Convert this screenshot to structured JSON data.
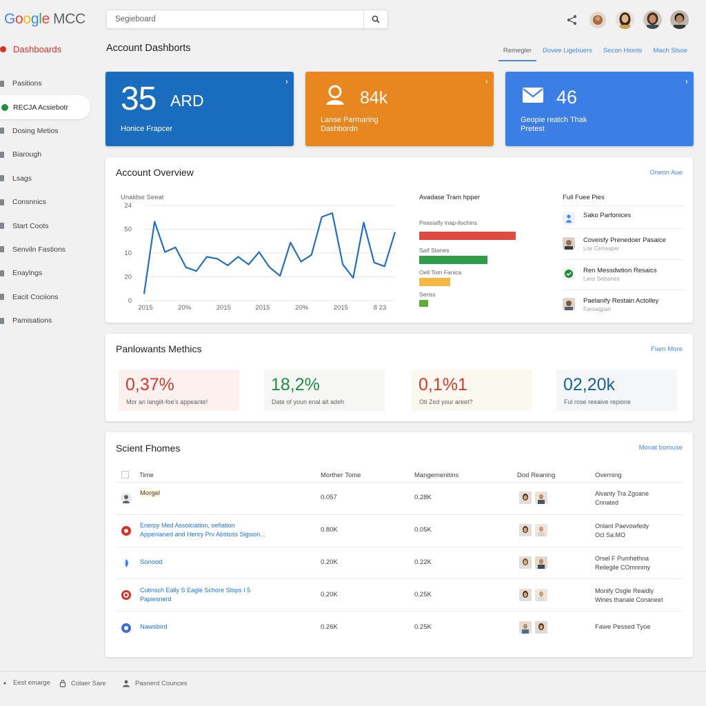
{
  "app": {
    "logo_word": "Google",
    "logo_suffix": "MCC"
  },
  "search": {
    "value": "Segieboard"
  },
  "sidebar": {
    "dashboards_label": "Dashboards",
    "items": [
      {
        "label": "Pasitions"
      },
      {
        "label": "RECJA Acsiebotr"
      },
      {
        "label": "Dosing Metios"
      },
      {
        "label": "Biarough"
      },
      {
        "label": "Lsags"
      },
      {
        "label": "Consnnics"
      },
      {
        "label": "Start Coots"
      },
      {
        "label": "Senviln Fastions"
      },
      {
        "label": "Enaylngs"
      },
      {
        "label": "Eacit Cociions"
      },
      {
        "label": "Pamisations"
      }
    ]
  },
  "header": {
    "title": "Account Dashborts",
    "tabs": [
      "Remegler",
      "Dovee Ligebuers",
      "Secon Hionts",
      "Mach Slsoe"
    ]
  },
  "kpis": [
    {
      "value": "35",
      "unit": "ARD",
      "label": "Honice Frapcer",
      "color": "#1a6cbf"
    },
    {
      "value": "84k",
      "label_line1": "Lanse Parmaring",
      "label_line2": "Dashbordn",
      "color": "#e8861f"
    },
    {
      "value": "46",
      "label_line1": "Geopie reatch Thak",
      "label_line2": "Pretest",
      "color": "#3b7ee6"
    }
  ],
  "overview": {
    "title": "Account Overview",
    "link": "Onenn Aue",
    "chart_title": "Unaldse Seeat",
    "bars_title": "Avadase Tram hpper",
    "bars": [
      {
        "label": "Peasiafly inap-ilochins",
        "value": 0.78,
        "color": "#e04b3f"
      },
      {
        "label": "Saif Stanes",
        "value": 0.55,
        "color": "#2e9e48"
      },
      {
        "label": "Oell Tom Fanica",
        "value": 0.25,
        "color": "#f5b942"
      },
      {
        "label": "Seriss",
        "value": 0.07,
        "color": "#5fae3a"
      }
    ],
    "list_title": "Full Fuee Pies",
    "list": [
      {
        "title": "Sako Parfonices",
        "sub": "",
        "icon": "person-icon"
      },
      {
        "title": "Coveisfy Prenedoer Pasaice",
        "sub": "Loe Cemsaper",
        "icon": "avatar-icon"
      },
      {
        "title": "Ren Messdwtion Resaics",
        "sub": "Lans Setssnes",
        "icon": "circle-check-icon"
      },
      {
        "title": "Paelanify Restain Actolley",
        "sub": "Fansagpan",
        "icon": "avatar-icon"
      }
    ]
  },
  "chart_data": {
    "type": "line",
    "title": "Unaldse Seeat",
    "y_tick_labels": [
      "24",
      "50",
      "10",
      "20",
      "0"
    ],
    "x_tick_labels": [
      "2015",
      "20%",
      "2015",
      "2015",
      "20%",
      "2015",
      "8 23"
    ],
    "series": [
      {
        "values": [
          7,
          83,
          51,
          56,
          35,
          31,
          46,
          44,
          37,
          46,
          38,
          51,
          35,
          26,
          61,
          41,
          48,
          88,
          92,
          38,
          24,
          82,
          40,
          36,
          72
        ]
      }
    ],
    "ylim": [
      0,
      100
    ],
    "grid": true,
    "color": "#1f6fc7"
  },
  "metrics": {
    "title": "Panlowants Methics",
    "link": "Fiarn More",
    "items": [
      {
        "value": "0,37%",
        "label": "Mor an langiit-foe's appeante!",
        "color": "#d33a2c",
        "bg": "#fdf1ef"
      },
      {
        "value": "18,2%",
        "label": "Date of youn enal alt adeh",
        "color": "#1e8e3e",
        "bg": "#f6f6f4"
      },
      {
        "value": "0,1%1",
        "label": "Oti Zed your areet?",
        "color": "#d33a2c",
        "bg": "#fbf8ef"
      },
      {
        "value": "02,20k",
        "label": "Ful rose reeaive repione",
        "color": "#1a5fa0",
        "bg": "#f4f6f8"
      }
    ]
  },
  "table": {
    "title": "Scient Fhomes",
    "link": "Monat bornuse",
    "columns": [
      "Time",
      "Morther Tome",
      "Mangemenitins",
      "Dod Reaning",
      "Overning"
    ],
    "rows": [
      {
        "name": "Morgel",
        "name2": "",
        "is_link": false,
        "col2": "0.057",
        "col3": "0.28K",
        "col5a": "Alvanty Tra Zgoane",
        "col5b": "Cnnated",
        "icon_color": "#5f6368"
      },
      {
        "name": "Enerpy Med Assoiciation, oefiation",
        "name2": "Appenianed and Henry Prv Abstoss Sigsion...",
        "is_link": true,
        "col2": "0.80K",
        "col3": "0.05K",
        "col5a": "Onlant Paevowfedy",
        "col5b": "Ocl Sa:MO",
        "icon_color": "#d93025"
      },
      {
        "name": "Sonood",
        "name2": "",
        "is_link": true,
        "col2": "0.20K",
        "col3": "0.22K",
        "col5a": "Orsel F Pumhethna",
        "col5b": "Reilegile COmnnmy",
        "icon_color": "#4285f4"
      },
      {
        "name": "Cutinsch Eally S Eagle Schore Stops I 5",
        "name2": "Papiesnerd",
        "is_link": true,
        "col2": "0.20K",
        "col3": "0.25K",
        "col5a": "Monify Osgle Reaidly",
        "col5b": "Wines thanale Conaneet",
        "icon_color": "#d93025"
      },
      {
        "name": "Nawsbird",
        "name2": "",
        "is_link": true,
        "col2": "0.26K",
        "col3": "0.25K",
        "col5a": "Fawe Pessed Tyoe",
        "col5b": "",
        "icon_color": "#3c6fd1"
      }
    ]
  },
  "footer": {
    "items": [
      "Eest emarge",
      "Colaer Sare",
      "Pasnerd Counces"
    ]
  }
}
